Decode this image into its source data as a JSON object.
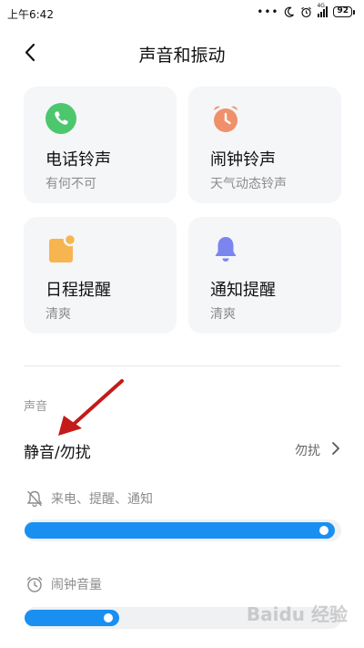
{
  "status_bar": {
    "time": "上午6:42",
    "dots": "•••",
    "network": "4G",
    "battery": "92"
  },
  "header": {
    "title": "声音和振动"
  },
  "cards": [
    {
      "title": "电话铃声",
      "subtitle": "有何不可",
      "icon": "phone-icon",
      "color": "#4cc76e"
    },
    {
      "title": "闹钟铃声",
      "subtitle": "天气动态铃声",
      "icon": "alarm-clock-icon",
      "color": "#f0906a"
    },
    {
      "title": "日程提醒",
      "subtitle": "清爽",
      "icon": "calendar-icon",
      "color": "#f7b550"
    },
    {
      "title": "通知提醒",
      "subtitle": "清爽",
      "icon": "bell-icon",
      "color": "#7a85f0"
    }
  ],
  "sound": {
    "section_label": "声音",
    "dnd": {
      "label": "静音/勿扰",
      "value": "勿扰"
    },
    "volumes": [
      {
        "label": "来电、提醒、通知",
        "icon": "bell-off-icon",
        "level": 0.98
      },
      {
        "label": "闹钟音量",
        "icon": "alarm-clock-icon",
        "level": 0.3
      }
    ]
  },
  "colors": {
    "accent": "#1a8ff2",
    "annotation_arrow": "#c41a1a"
  },
  "watermark": "Baidu 经验"
}
